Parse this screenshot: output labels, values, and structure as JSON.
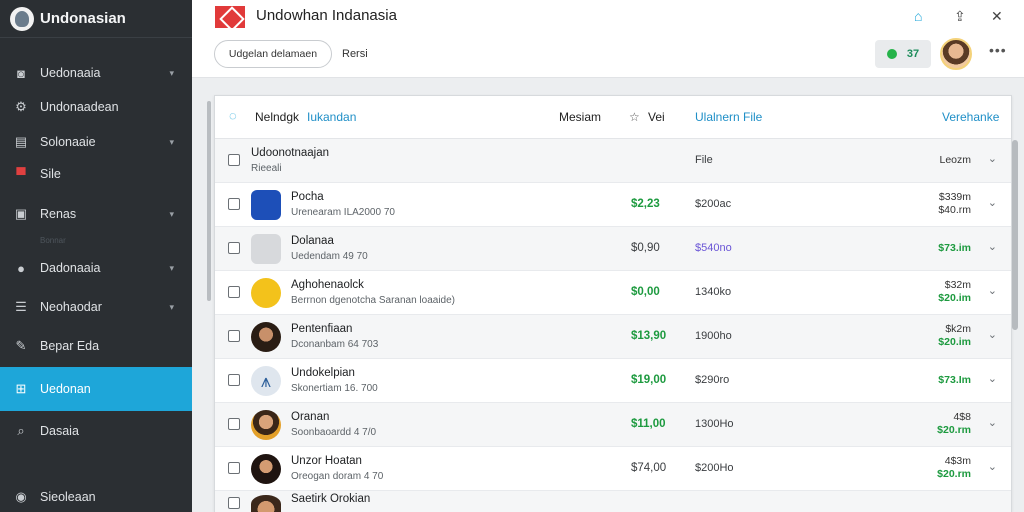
{
  "sidebar": {
    "brand": "Undonasian",
    "items": [
      {
        "label": "Uedonaaia",
        "icon": "camera-icon",
        "chevron": true
      },
      {
        "label": "Undonaadean",
        "icon": "gear-icon",
        "chevron": false
      },
      {
        "label": "Solonaaie",
        "icon": "document-icon",
        "chevron": true
      },
      {
        "label": "Sile",
        "icon": "flag-icon",
        "chevron": false
      },
      {
        "label": "Renas",
        "icon": "bag-icon",
        "chevron": true
      },
      {
        "label": "Dadonaaia",
        "icon": "person-icon",
        "chevron": true
      },
      {
        "label": "Neohaodar",
        "icon": "list-icon",
        "chevron": true
      },
      {
        "label": "Bepar Eda",
        "icon": "pencil-icon",
        "chevron": false
      },
      {
        "label": "Uedonan",
        "icon": "grid-icon",
        "chevron": false
      },
      {
        "label": "Dasaia",
        "icon": "search-icon",
        "chevron": false
      },
      {
        "label": "Sieoleaan",
        "icon": "user-circle-icon",
        "chevron": false
      }
    ],
    "sub_caption": "Bonnar"
  },
  "topbar": {
    "title": "Undowhan Indanasia"
  },
  "subbar": {
    "pill_label": "Udgelan delamaen",
    "label": "Rersi",
    "status_count": "37"
  },
  "table": {
    "header": {
      "search_label": "Nelndgk",
      "link1": "Iukandan",
      "col_name": "Mesiam",
      "col_star": "Vei",
      "col_file": "Ulalnern File",
      "col_right": "Verehanke"
    },
    "rows": [
      {
        "name": "Udoonotnaajan",
        "sub": "Rieeali",
        "price": "",
        "file": "File",
        "right1": "Leozm",
        "right2": ""
      },
      {
        "name": "Pocha",
        "sub": "Urenearam ILA2000 70",
        "price": "$2,23",
        "file": "$200ac",
        "right1": "$339m",
        "right2": "$40.rm"
      },
      {
        "name": "Dolanaa",
        "sub": "Uedendam 49 70",
        "price": "$0,90",
        "file": "$540no",
        "right1": "$73.im",
        "right2": ""
      },
      {
        "name": "Aghohenaolck",
        "sub": "Berrnon dgenotcha Saranan loaaide)",
        "price": "$0,00",
        "file": "1340ko",
        "right1": "$32m",
        "right2": "$20.im"
      },
      {
        "name": "Pentenfiaan",
        "sub": "Dconanbam 64 703",
        "price": "$13,90",
        "file": "1900ho",
        "right1": "$k2m",
        "right2": "$20.im"
      },
      {
        "name": "Undokelpian",
        "sub": "Skonertiam 16. 700",
        "price": "$19,00",
        "file": "$290ro",
        "right1": "$73.Im",
        "right2": ""
      },
      {
        "name": "Oranan",
        "sub": "Soonbaoardd 4 7/0",
        "price": "$11,00",
        "file": "1300Ho",
        "right1": "4$8",
        "right2": "$20.rm"
      },
      {
        "name": "Unzor Hoatan",
        "sub": "Oreogan doram 4 70",
        "price": "$74,00",
        "file": "$200Ho",
        "right1": "4$3m",
        "right2": "$20.rm"
      },
      {
        "name": "Saetirk Orokian",
        "sub": "",
        "price": "",
        "file": "",
        "right1": "",
        "right2": ""
      }
    ]
  },
  "colors": {
    "accent": "#1ea6d9",
    "sidebar_bg": "#2b2f33",
    "green": "#1d9a3f",
    "purple": "#6a55d6"
  }
}
